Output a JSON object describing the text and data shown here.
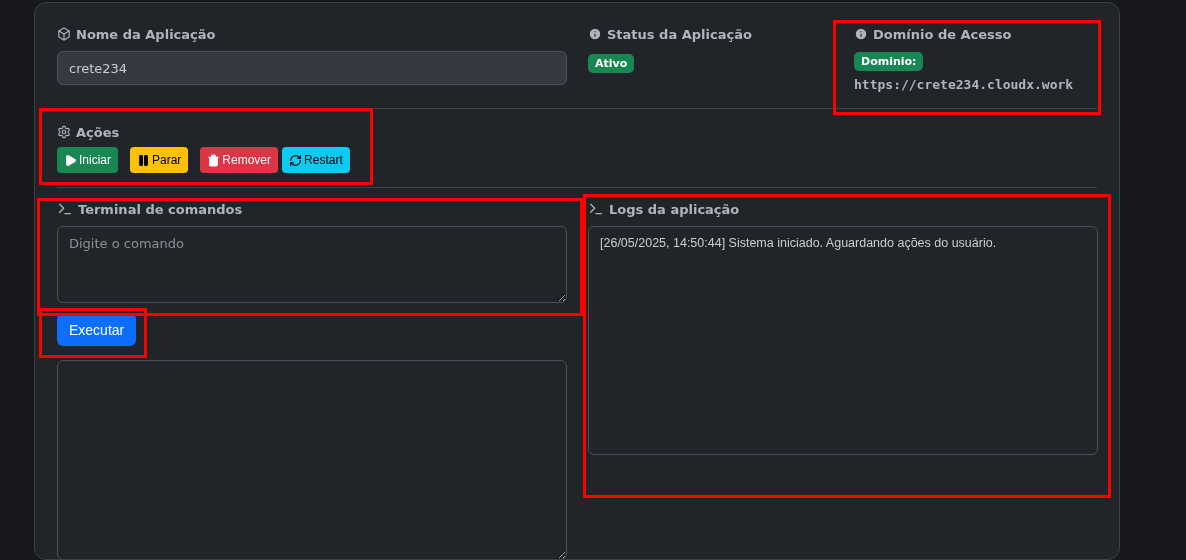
{
  "app_name": {
    "label": "Nome da Aplicação",
    "value": "crete234"
  },
  "status": {
    "label": "Status da Aplicação",
    "badge": "Ativo"
  },
  "domain": {
    "label": "Domínio de Acesso",
    "badge": "Dominio:",
    "url": "https://crete234.cloudx.work"
  },
  "actions": {
    "label": "Ações",
    "buttons": [
      {
        "kind": "start",
        "label": "Iniciar"
      },
      {
        "kind": "stop",
        "label": "Parar"
      },
      {
        "kind": "remove",
        "label": "Remover"
      },
      {
        "kind": "restart",
        "label": "Restart"
      }
    ]
  },
  "terminal": {
    "label": "Terminal de comandos",
    "placeholder": "Digite o comando",
    "button": "Executar"
  },
  "logs": {
    "label": "Logs da aplicação",
    "lines": [
      "[26/05/2025, 14:50:44] Sistema iniciado. Aguardando ações do usuário."
    ]
  }
}
